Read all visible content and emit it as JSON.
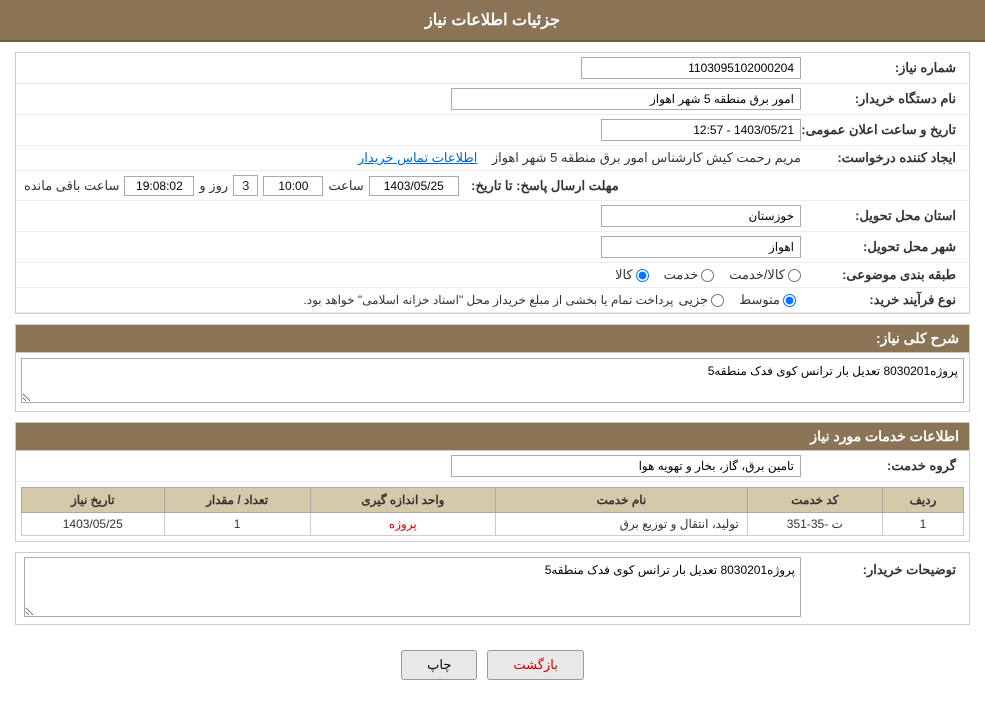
{
  "header": {
    "title": "جزئیات اطلاعات نیاز"
  },
  "form": {
    "need_number_label": "شماره نیاز:",
    "need_number_value": "1103095102000204",
    "buyer_org_label": "نام دستگاه خریدار:",
    "buyer_org_value": "امور برق منطقه 5 شهر اهواز",
    "announcement_datetime_label": "تاریخ و ساعت اعلان عمومی:",
    "announcement_datetime_value": "1403/05/21 - 12:57",
    "creator_label": "ایجاد کننده درخواست:",
    "creator_value": "مریم رحمت کیش کارشناس امور برق منطقه 5 شهر اهواز",
    "contact_info_link": "اطلاعات تماس خریدار",
    "response_deadline_label": "مهلت ارسال پاسخ: تا تاریخ:",
    "response_date_value": "1403/05/25",
    "response_time_label": "ساعت",
    "response_time_value": "10:00",
    "remaining_days_label": "روز و",
    "remaining_days_value": "3",
    "remaining_time_value": "19:08:02",
    "remaining_time_label": "ساعت باقی مانده",
    "delivery_province_label": "استان محل تحویل:",
    "delivery_province_value": "خوزستان",
    "delivery_city_label": "شهر محل تحویل:",
    "delivery_city_value": "اهواز",
    "category_label": "طبقه بندی موضوعی:",
    "category_options": [
      "کالا",
      "خدمت",
      "کالا/خدمت"
    ],
    "category_selected": "کالا",
    "process_type_label": "نوع فرآیند خرید:",
    "process_options": [
      "جزیی",
      "متوسط"
    ],
    "process_selected": "متوسط",
    "process_note": "پرداخت تمام یا بخشی از مبلغ خریداز محل \"اسناد خزانه اسلامی\" خواهد بود.",
    "general_description_label": "شرح کلی نیاز:",
    "general_description_value": "پروژه8030201 تعدیل بار ترانس کوی فدک منطقه5",
    "services_section_title": "اطلاعات خدمات مورد نیاز",
    "service_group_label": "گروه خدمت:",
    "service_group_value": "تامین برق، گاز، بخار و تهویه هوا",
    "table": {
      "headers": [
        "ردیف",
        "کد خدمت",
        "نام خدمت",
        "واحد اندازه گیری",
        "تعداد / مقدار",
        "تاریخ نیاز"
      ],
      "rows": [
        {
          "row_num": "1",
          "service_code": "ت -35-351",
          "service_name": "تولید، انتقال و توزیع برق",
          "unit": "پروژه",
          "quantity": "1",
          "date": "1403/05/25"
        }
      ]
    },
    "buyer_description_label": "توضیحات خریدار:",
    "buyer_description_value": "پروژه8030201 تعدیل بار ترانس کوی فدک منطقه5"
  },
  "buttons": {
    "print_label": "چاپ",
    "back_label": "بازگشت"
  }
}
